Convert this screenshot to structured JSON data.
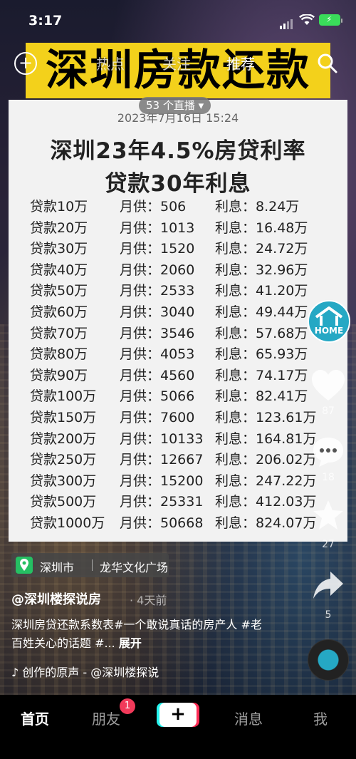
{
  "status_bar": {
    "time": "3:17"
  },
  "top_nav": {
    "tabs": [
      "热点",
      "关注",
      "推荐"
    ],
    "active_index": 2
  },
  "banner_title": "深圳房款还款",
  "live_pill": "53 个直播 ▾",
  "card": {
    "date": "2023年7月16日 15:24",
    "title_line1": "深圳23年4.5%房贷利率",
    "title_line2": "贷款30年利息",
    "rows": [
      {
        "loan": "贷款10万",
        "monthly": "月供：506",
        "interest": "利息：8.24万"
      },
      {
        "loan": "贷款20万",
        "monthly": "月供：1013",
        "interest": "利息：16.48万"
      },
      {
        "loan": "贷款30万",
        "monthly": "月供：1520",
        "interest": "利息：24.72万"
      },
      {
        "loan": "贷款40万",
        "monthly": "月供：2060",
        "interest": "利息：32.96万"
      },
      {
        "loan": "贷款50万",
        "monthly": "月供：2533",
        "interest": "利息：41.20万"
      },
      {
        "loan": "贷款60万",
        "monthly": "月供：3040",
        "interest": "利息：49.44万"
      },
      {
        "loan": "贷款70万",
        "monthly": "月供：3546",
        "interest": "利息：57.68万"
      },
      {
        "loan": "贷款80万",
        "monthly": "月供：4053",
        "interest": "利息：65.93万"
      },
      {
        "loan": "贷款90万",
        "monthly": "月供：4560",
        "interest": "利息：74.17万"
      },
      {
        "loan": "贷款100万",
        "monthly": "月供：5066",
        "interest": "利息：82.41万"
      },
      {
        "loan": "贷款150万",
        "monthly": "月供：7600",
        "interest": "利息：123.61万"
      },
      {
        "loan": "贷款200万",
        "monthly": "月供：10133",
        "interest": "利息：164.81万"
      },
      {
        "loan": "贷款250万",
        "monthly": "月供：12667",
        "interest": "利息：206.02万"
      },
      {
        "loan": "贷款300万",
        "monthly": "月供：15200",
        "interest": "利息：247.22万"
      },
      {
        "loan": "贷款500万",
        "monthly": "月供：25331",
        "interest": "利息：412.03万"
      },
      {
        "loan": "贷款1000万",
        "monthly": "月供：50668",
        "interest": "利息：824.07万"
      }
    ]
  },
  "right_rail": {
    "home_badge_label": "HOME",
    "like_count": "87",
    "comment_count": "18",
    "favorite_count": "27",
    "share_count": "5"
  },
  "location": {
    "city": "深圳市",
    "place": "龙华文化广场"
  },
  "post": {
    "author": "@深圳楼探说房",
    "time": "· 4天前",
    "description": "深圳房贷还款系数表#一个敢说真话的房产人 #老百姓关心的话题 #...",
    "more_label": "展开",
    "music": "♪ 创作的原声 - @深圳楼探说"
  },
  "tab_bar": {
    "tabs": [
      "首页",
      "朋友",
      "消息",
      "我"
    ],
    "active_index": 0,
    "friends_badge": "1",
    "create_label": "+"
  },
  "colors": {
    "banner_yellow": "#f3d11b",
    "home_teal": "#25a8c4",
    "badge_red": "#f23a5a",
    "tiktok_cyan": "#25f4ee",
    "tiktok_red": "#fe2c55"
  }
}
